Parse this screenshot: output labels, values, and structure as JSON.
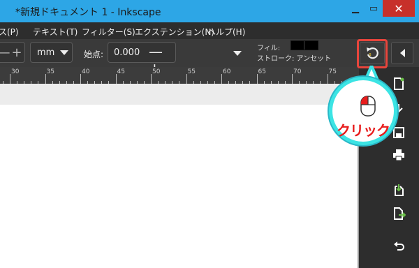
{
  "window": {
    "title": "*新規ドキュメント 1 - Inkscape",
    "minimize_glyph": "▁",
    "maximize_glyph": "▭",
    "close_glyph": "✕"
  },
  "menu": {
    "items": [
      {
        "label": "パス(P)"
      },
      {
        "label": "テキスト(T)"
      },
      {
        "label": "フィルター(S)"
      },
      {
        "label": "エクステンション(N)"
      },
      {
        "label": "ヘルプ(H)"
      }
    ]
  },
  "toolbar": {
    "left_stepper": "—+",
    "unit_value": "mm",
    "start_label": "始点:",
    "start_value": "0.000",
    "start_stepper": "—+",
    "fill_label": "フィル:",
    "stroke_label": "ストローク: アンセット",
    "fill_color": "#000000"
  },
  "ruler": {
    "labels": [
      "30",
      "35",
      "40",
      "45",
      "50",
      "55",
      "60",
      "65",
      "70",
      "75"
    ]
  },
  "commands": {
    "rotate_icon": "rotate-ccw-icon",
    "collapse_icon": "triangle-left-icon",
    "icons": [
      "new-document-icon",
      "open-icon",
      "save-icon",
      "print-icon",
      "import-icon",
      "export-icon",
      "undo-icon"
    ]
  },
  "callout": {
    "text": "クリック",
    "border_color": "#3ce4e4",
    "text_color": "#e81c1c",
    "highlight_color": "#e8453c"
  }
}
